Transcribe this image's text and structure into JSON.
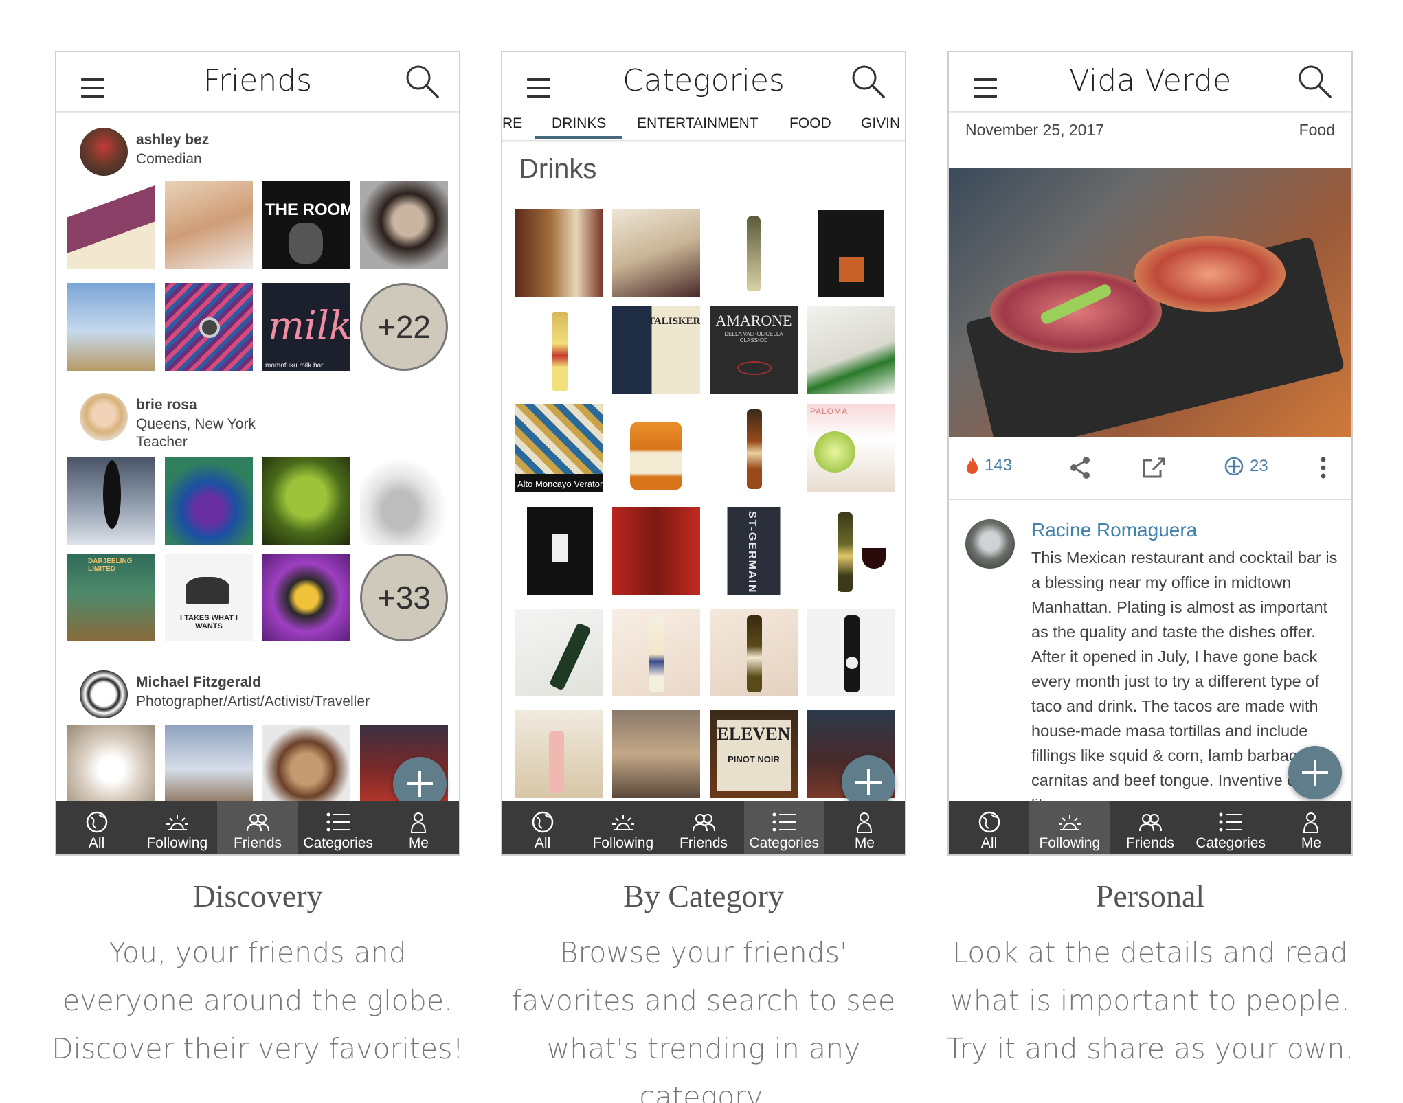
{
  "screens": {
    "friends": {
      "title": "Friends",
      "users": [
        {
          "name": "ashley bez",
          "lines": [
            "Comedian"
          ],
          "more": "+22",
          "thumb4_text": "THE ROOM",
          "thumb7_text": "milk",
          "thumb7_caption": "momofuku milk bar"
        },
        {
          "name": "brie rosa",
          "lines": [
            "Queens, New York",
            "Teacher"
          ],
          "more": "+33",
          "thumb6_text": "I TAKES WHAT I WANTS",
          "thumb5_text": "DARJEELING LIMITED"
        },
        {
          "name": "Michael Fitzgerald",
          "lines": [
            "Photographer/Artist/Activist/Traveller"
          ]
        }
      ]
    },
    "categories": {
      "title": "Categories",
      "tabs": [
        "RE",
        "DRINKS",
        "ENTERTAINMENT",
        "FOOD",
        "GIVIN"
      ],
      "active_tab": "DRINKS",
      "section_title": "Drinks",
      "label_texts": {
        "talisker": "TALISKER",
        "amarone": "AMARONE",
        "amarone_sub": "DELLA VALPOLICELLA CLASSICO",
        "veraton": "Alto Moncayo Veraton",
        "paloma": "PALOMA",
        "stgermain": "ST-GERMAIN",
        "eleven": "ELEVEN",
        "pinot": "PINOT NOIR"
      }
    },
    "detail": {
      "title": "Vida Verde",
      "date": "November 25, 2017",
      "category": "Food",
      "likes": "143",
      "saves": "23",
      "commenter": "Racine Romaguera",
      "review": "This Mexican restaurant and cocktail bar is a blessing near my office in midtown Manhattan. Plating is almost as important as the quality and taste the dishes offer. After it opened in July, I have gone back every month just to try a different type of taco and drink. The tacos are made with house-made masa tortillas and include fillings like squid & corn, lamb barbacoa, carnitas and beef tongue. Inventive drinks like"
    }
  },
  "tabbar": [
    "All",
    "Following",
    "Friends",
    "Categories",
    "Me"
  ],
  "active_tabs": {
    "friends": "Friends",
    "categories": "Categories",
    "detail": "Following"
  },
  "captions": [
    {
      "title": "Discovery",
      "body": "You, your friends and everyone around the globe. Discover their very favorites!"
    },
    {
      "title": "By Category",
      "body": "Browse your friends' favorites and search to see what's trending in any category."
    },
    {
      "title": "Personal",
      "body": "Look at the details and read what is important to people. Try it and share as your own."
    }
  ],
  "colors": {
    "tabbar": "#3a3a3a",
    "fab": "#607d8b",
    "accent": "#45687e",
    "link": "#3f82ad",
    "flame": "#e8532a"
  },
  "icons": [
    "menu-icon",
    "search-icon",
    "globe-icon",
    "sunrise-icon",
    "people-icon",
    "list-icon",
    "person-icon",
    "flame-icon",
    "share-icon",
    "open-external-icon",
    "save-icon",
    "more-vert-icon",
    "plus-icon"
  ]
}
